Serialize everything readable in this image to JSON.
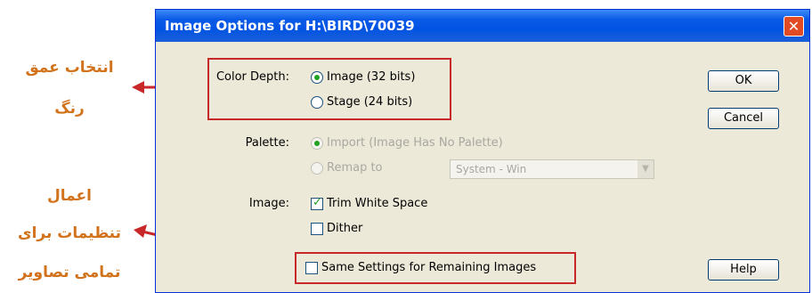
{
  "annotations": {
    "color_depth_line1": "انتخاب عمق",
    "color_depth_line2": "رنگ",
    "apply_line1": "اعمال",
    "apply_line2": "تنظیمات برای",
    "apply_line3": "تمامی تصاویر",
    "color": "#d2731c",
    "box_color": "#c8282a"
  },
  "dialog": {
    "title": "Image Options for H:\\BIRD\\70039",
    "close_glyph": "✕",
    "color_depth": {
      "label": "Color Depth:",
      "options": [
        {
          "label": "Image (32 bits)",
          "selected": true
        },
        {
          "label": "Stage (24 bits)",
          "selected": false
        }
      ]
    },
    "palette": {
      "label": "Palette:",
      "import_label": "Import (Image Has No Palette)",
      "remap_label": "Remap to",
      "remap_value": "System - Win"
    },
    "image": {
      "label": "Image:",
      "trim_white_space": {
        "label": "Trim White Space",
        "checked": true
      },
      "dither": {
        "label": "Dither",
        "checked": false
      }
    },
    "same_settings": {
      "label": "Same Settings for Remaining Images",
      "checked": false
    },
    "buttons": {
      "ok": "OK",
      "cancel": "Cancel",
      "help": "Help"
    },
    "title_color": "#0054e3"
  }
}
